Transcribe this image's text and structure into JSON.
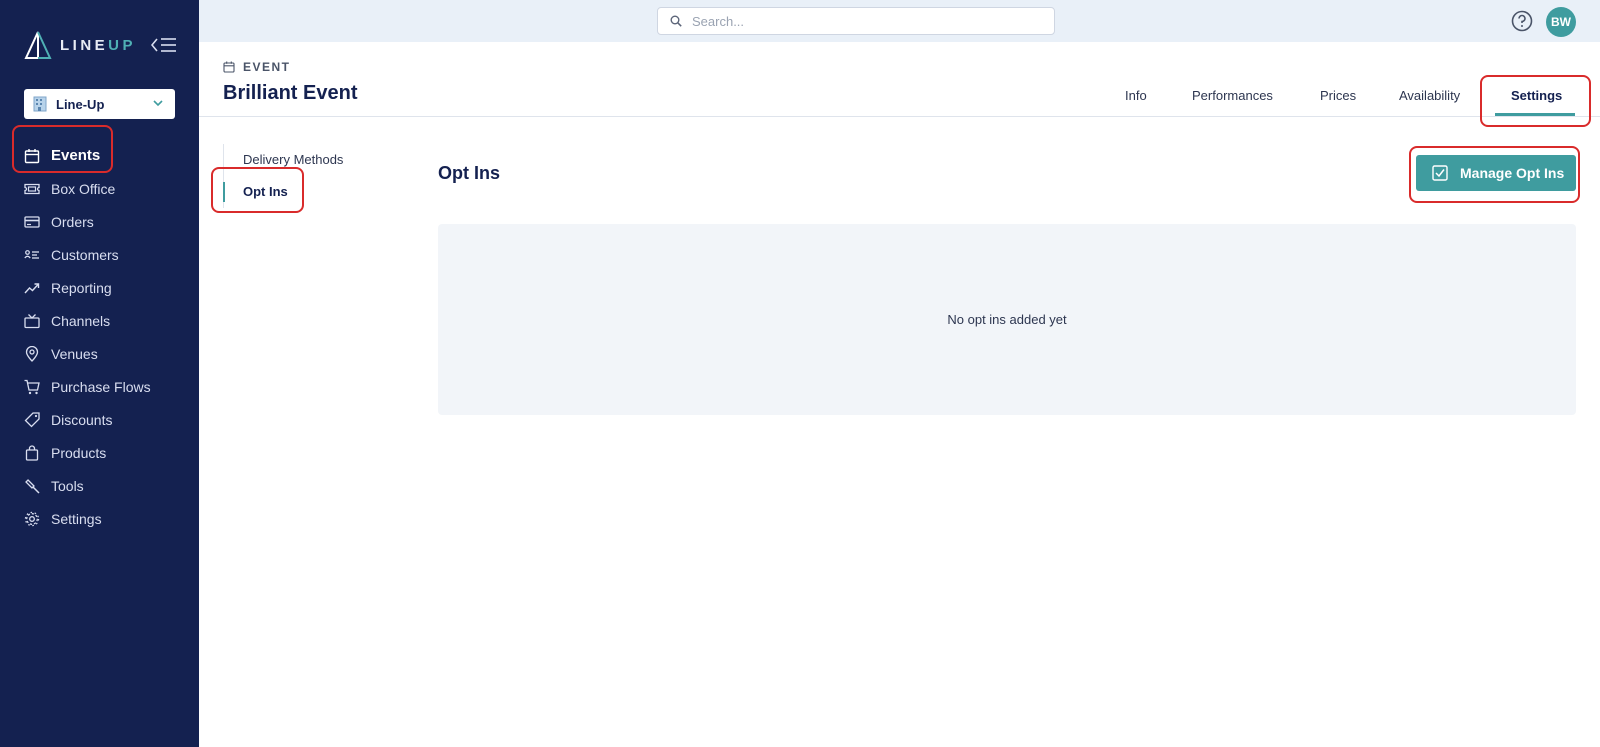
{
  "app": {
    "logo_left": "LINE",
    "logo_right": "UP"
  },
  "sidebar": {
    "org_name": "Line-Up",
    "items": [
      {
        "label": "Events",
        "icon": "calendar-icon",
        "active": true
      },
      {
        "label": "Box Office",
        "icon": "ticket-icon"
      },
      {
        "label": "Orders",
        "icon": "credit-card-icon"
      },
      {
        "label": "Customers",
        "icon": "customers-list-icon"
      },
      {
        "label": "Reporting",
        "icon": "trend-chart-icon"
      },
      {
        "label": "Channels",
        "icon": "tv-icon"
      },
      {
        "label": "Venues",
        "icon": "map-pin-icon"
      },
      {
        "label": "Purchase Flows",
        "icon": "cart-icon"
      },
      {
        "label": "Discounts",
        "icon": "tag-icon"
      },
      {
        "label": "Products",
        "icon": "bag-icon"
      },
      {
        "label": "Tools",
        "icon": "hammer-icon"
      },
      {
        "label": "Settings",
        "icon": "gear-icon"
      }
    ]
  },
  "topbar": {
    "search_placeholder": "Search...",
    "avatar_initials": "BW"
  },
  "header": {
    "breadcrumb": "EVENT",
    "title": "Brilliant Event",
    "tabs": [
      {
        "label": "Info"
      },
      {
        "label": "Performances"
      },
      {
        "label": "Prices"
      },
      {
        "label": "Availability"
      },
      {
        "label": "Settings",
        "active": true
      }
    ]
  },
  "subnav": {
    "items": [
      {
        "label": "Delivery Methods"
      },
      {
        "label": "Opt Ins",
        "active": true
      }
    ]
  },
  "main": {
    "section_title": "Opt Ins",
    "manage_button": "Manage Opt Ins",
    "empty_message": "No opt ins added yet"
  },
  "colors": {
    "sidebar_bg": "#142150",
    "accent": "#3f9c9f",
    "annotation_red": "#d92b2b"
  }
}
